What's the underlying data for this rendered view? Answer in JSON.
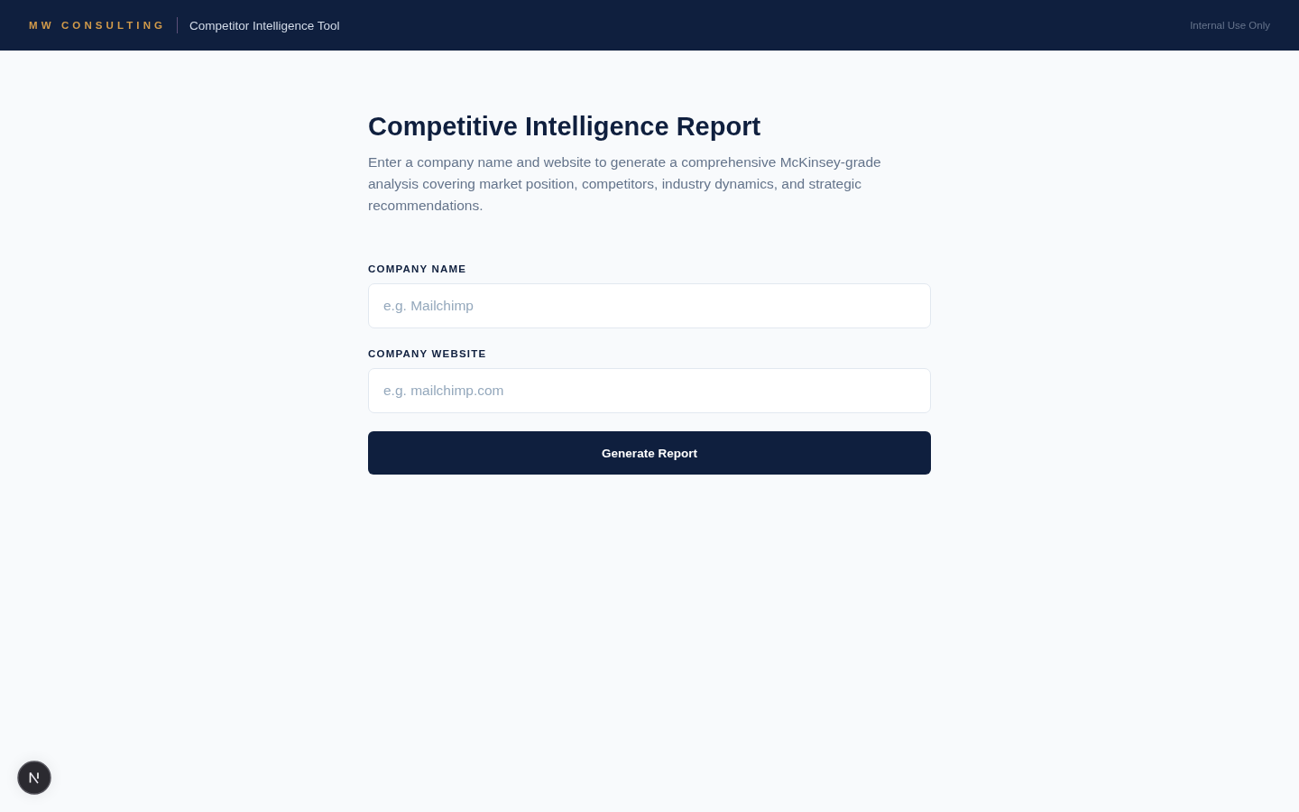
{
  "header": {
    "brand": "MW CONSULTING",
    "tool_name": "Competitor Intelligence Tool",
    "notice": "Internal Use Only"
  },
  "page": {
    "title": "Competitive Intelligence Report",
    "description": "Enter a company name and website to generate a comprehensive McKinsey-grade analysis covering market position, competitors, industry dynamics, and strategic recommendations."
  },
  "form": {
    "fields": [
      {
        "label": "COMPANY NAME",
        "placeholder": "e.g. Mailchimp"
      },
      {
        "label": "COMPANY WEBSITE",
        "placeholder": "e.g. mailchimp.com"
      }
    ],
    "submit": "Generate Report"
  }
}
